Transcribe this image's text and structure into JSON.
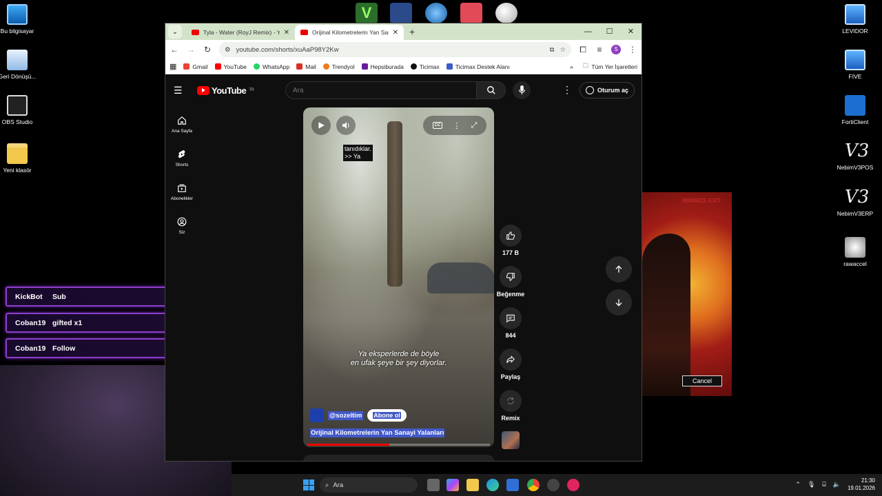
{
  "desktop": {
    "left_icons": [
      {
        "label": "Bu bilgisayar",
        "icon": "computer-icon"
      },
      {
        "label": "Geri Dönüşü...",
        "icon": "recycle-bin-icon"
      },
      {
        "label": "OBS Studio",
        "icon": "obs-icon"
      },
      {
        "label": "Yeni klasör",
        "icon": "folder-icon"
      }
    ],
    "right_icons": [
      {
        "label": "LEVIDOR",
        "icon": "monitor-shortcut-icon"
      },
      {
        "label": "FIVE",
        "icon": "monitor-shortcut-icon"
      },
      {
        "label": "FortiClient",
        "icon": "forticlient-icon"
      },
      {
        "label": "NebimV3POS",
        "icon": "nebim-v3-icon"
      },
      {
        "label": "NebimV3ERP",
        "icon": "nebim-v3-icon"
      },
      {
        "label": "rawaccel",
        "icon": "rawaccel-icon"
      }
    ]
  },
  "browser": {
    "tabs": [
      {
        "title": "Tyla - Water (RoyJ Remix) - You",
        "active": false
      },
      {
        "title": "Orijinal Kilometrelerin Yan Sanayi",
        "active": true
      }
    ],
    "url": "youtube.com/shorts/xuAaP98Y2Kw",
    "profile_initial": "S",
    "bookmarks": [
      {
        "label": "Gmail",
        "color": "#ea4335"
      },
      {
        "label": "YouTube",
        "color": "#ff0000"
      },
      {
        "label": "WhatsApp",
        "color": "#25d366"
      },
      {
        "label": "Mail",
        "color": "#d93025"
      },
      {
        "label": "Trendyol",
        "color": "#f27a1a"
      },
      {
        "label": "Hepsiburada",
        "color": "#6a1b9a"
      },
      {
        "label": "Ticimax",
        "color": "#111111"
      },
      {
        "label": "Ticimax Destek Alanı",
        "color": "#3a5cc9"
      }
    ],
    "all_bookmarks": "Tüm Yer İşaretleri"
  },
  "youtube": {
    "logo_text": "YouTube",
    "region": "TR",
    "search_placeholder": "Ara",
    "signin_label": "Oturum aç",
    "nav": [
      {
        "label": "Ana Sayfa",
        "icon": "home-icon"
      },
      {
        "label": "Shorts",
        "icon": "shorts-icon"
      },
      {
        "label": "Abonelikler",
        "icon": "subscriptions-icon"
      },
      {
        "label": "Siz",
        "icon": "profile-icon"
      }
    ],
    "short": {
      "caption_line1": "tanıdıklar.",
      "caption_line2": ">> Ya",
      "subtitle_line1": "Ya eksperlerde de böyle",
      "subtitle_line2": "en ufak şeye bir şey diyorlar.",
      "channel": "@sozeltim",
      "subscribe": "Abone ol",
      "title": "Orijinal Kilometrelerin Yan Sanayi Yalanları",
      "progress": 0.45,
      "cc": "CC"
    },
    "actions": {
      "likes": "177 B",
      "dislike": "Beğenme",
      "comments": "844",
      "share": "Paylaş",
      "remix": "Remix"
    }
  },
  "alerts": [
    {
      "user": "KickBot",
      "text": "Sub"
    },
    {
      "user": "Coban19",
      "text": "gifted x1"
    },
    {
      "user": "Coban19",
      "text": "Follow"
    }
  ],
  "side_window": {
    "header": "MINIMIZE EXIT",
    "cancel": "Cancel"
  },
  "taskbar": {
    "search_placeholder": "Ara",
    "time": "21:30",
    "date": "19.01.2026"
  }
}
